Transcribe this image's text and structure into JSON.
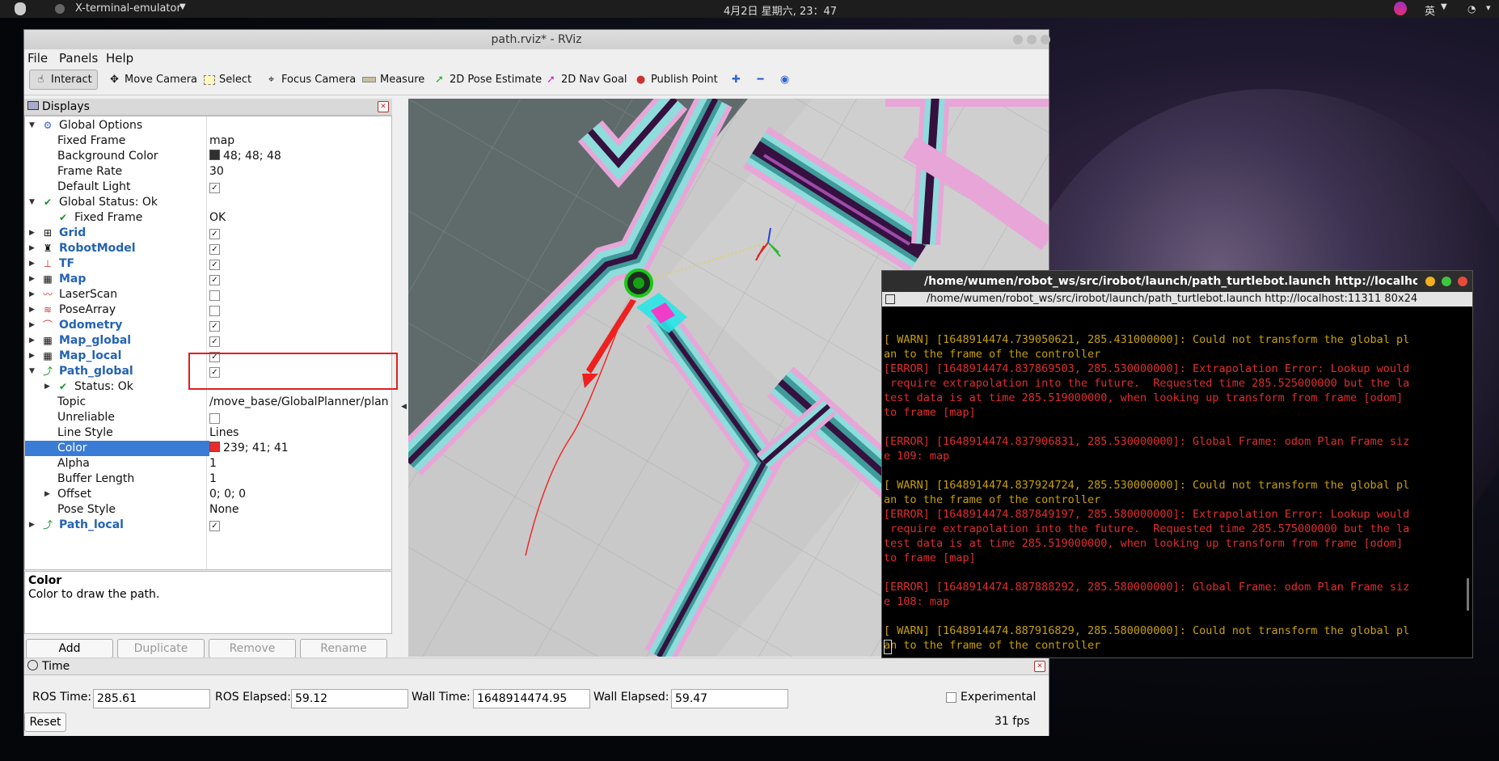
{
  "topbar": {
    "app_name": "X-terminal-emulator",
    "clock": "4月2日 星期六, 23：47",
    "ime": "英"
  },
  "rviz": {
    "title": "path.rviz* - RViz",
    "menu": [
      "File",
      "Panels",
      "Help"
    ],
    "tools": [
      "Interact",
      "Move Camera",
      "Select",
      "Focus Camera",
      "Measure",
      "2D Pose Estimate",
      "2D Nav Goal",
      "Publish Point"
    ],
    "displays_header": "Displays",
    "tree": [
      {
        "label": "Global Options",
        "value": ""
      },
      {
        "label": "Fixed Frame",
        "value": "map"
      },
      {
        "label": "Background Color",
        "value": "48; 48; 48"
      },
      {
        "label": "Frame Rate",
        "value": "30"
      },
      {
        "label": "Default Light",
        "value": "✓"
      },
      {
        "label": "Global Status: Ok",
        "value": ""
      },
      {
        "label": "Fixed Frame",
        "value": "OK"
      },
      {
        "label": "Grid",
        "value": "✓"
      },
      {
        "label": "RobotModel",
        "value": "✓"
      },
      {
        "label": "TF",
        "value": "✓"
      },
      {
        "label": "Map",
        "value": "✓"
      },
      {
        "label": "LaserScan",
        "value": ""
      },
      {
        "label": "PoseArray",
        "value": ""
      },
      {
        "label": "Odometry",
        "value": "✓"
      },
      {
        "label": "Map_global",
        "value": "✓"
      },
      {
        "label": "Map_local",
        "value": "✓"
      },
      {
        "label": "Path_global",
        "value": "✓"
      },
      {
        "label": "Status: Ok",
        "value": ""
      },
      {
        "label": "Topic",
        "value": "/move_base/GlobalPlanner/plan"
      },
      {
        "label": "Unreliable",
        "value": ""
      },
      {
        "label": "Line Style",
        "value": "Lines"
      },
      {
        "label": "Color",
        "value": "239; 41; 41"
      },
      {
        "label": "Alpha",
        "value": "1"
      },
      {
        "label": "Buffer Length",
        "value": "1"
      },
      {
        "label": "Offset",
        "value": "0; 0; 0"
      },
      {
        "label": "Pose Style",
        "value": "None"
      },
      {
        "label": "Path_local",
        "value": "✓"
      }
    ],
    "desc_title": "Color",
    "desc_text": "Color to draw the path.",
    "buttons": {
      "add": "Add",
      "duplicate": "Duplicate",
      "remove": "Remove",
      "rename": "Rename"
    },
    "time": {
      "header": "Time",
      "ros_time_label": "ROS Time:",
      "ros_time": "285.61",
      "ros_elapsed_label": "ROS Elapsed:",
      "ros_elapsed": "59.12",
      "wall_time_label": "Wall Time:",
      "wall_time": "1648914474.95",
      "wall_elapsed_label": "Wall Elapsed:",
      "wall_elapsed": "59.47",
      "experimental": "Experimental",
      "reset": "Reset",
      "fps": "31 fps"
    }
  },
  "terminal": {
    "title": "/home/wumen/robot_ws/src/irobot/launch/path_turtlebot.launch http://localhost:11311",
    "subtitle": "/home/wumen/robot_ws/src/irobot/launch/path_turtlebot.launch http://localhost:11311 80x24",
    "lines": [
      {
        "t": "",
        "c": "warn"
      },
      {
        "t": "[ WARN] [1648914474.739050621, 285.431000000]: Could not transform the global pl",
        "c": "warn"
      },
      {
        "t": "an to the frame of the controller",
        "c": "warn"
      },
      {
        "t": "[ERROR] [1648914474.837869503, 285.530000000]: Extrapolation Error: Lookup would",
        "c": "err"
      },
      {
        "t": " require extrapolation into the future.  Requested time 285.525000000 but the la",
        "c": "err"
      },
      {
        "t": "test data is at time 285.519000000, when looking up transform from frame [odom]",
        "c": "err"
      },
      {
        "t": "to frame [map]",
        "c": "err"
      },
      {
        "t": "",
        "c": "err"
      },
      {
        "t": "[ERROR] [1648914474.837906831, 285.530000000]: Global Frame: odom Plan Frame siz",
        "c": "err"
      },
      {
        "t": "e 109: map",
        "c": "err"
      },
      {
        "t": "",
        "c": "err"
      },
      {
        "t": "[ WARN] [1648914474.837924724, 285.530000000]: Could not transform the global pl",
        "c": "warn"
      },
      {
        "t": "an to the frame of the controller",
        "c": "warn"
      },
      {
        "t": "[ERROR] [1648914474.887849197, 285.580000000]: Extrapolation Error: Lookup would",
        "c": "err"
      },
      {
        "t": " require extrapolation into the future.  Requested time 285.575000000 but the la",
        "c": "err"
      },
      {
        "t": "test data is at time 285.519000000, when looking up transform from frame [odom]",
        "c": "err"
      },
      {
        "t": "to frame [map]",
        "c": "err"
      },
      {
        "t": "",
        "c": "err"
      },
      {
        "t": "[ERROR] [1648914474.887888292, 285.580000000]: Global Frame: odom Plan Frame siz",
        "c": "err"
      },
      {
        "t": "e 108: map",
        "c": "err"
      },
      {
        "t": "",
        "c": "err"
      },
      {
        "t": "[ WARN] [1648914474.887916829, 285.580000000]: Could not transform the global pl",
        "c": "warn"
      },
      {
        "t": "an to the frame of the controller",
        "c": "warn"
      }
    ]
  },
  "colors": {
    "accent": "#3a7bd5",
    "path_red": "#ef2929",
    "warn": "#c8a000",
    "error": "#e02d2d",
    "costmap_teal": "#54c5c5",
    "wall": "#3a0f42"
  }
}
